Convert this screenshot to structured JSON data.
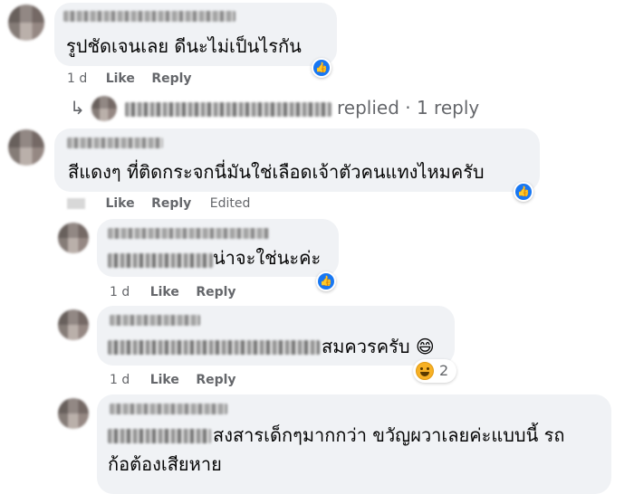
{
  "comments": [
    {
      "text": "รูปชัดเจนเลย ดีนะไม่เป็นไรกัน",
      "meta": {
        "time": "1 d",
        "like": "Like",
        "reply": "Reply"
      },
      "reaction": "like-icon",
      "replies_summary": {
        "text": "replied · 1 reply"
      }
    },
    {
      "text": "สีแดงๆ ที่ติดกระจกนี่มันใช่เลือดเจ้าตัวคนแทงไหมครับ",
      "meta": {
        "like": "Like",
        "reply": "Reply",
        "edited": "Edited"
      },
      "reaction": "like-icon",
      "replies": [
        {
          "text": "น่าจะใช่นะค่ะ",
          "meta": {
            "time": "1 d",
            "like": "Like",
            "reply": "Reply"
          },
          "reaction": "like-icon"
        },
        {
          "text": "สมควรครับ 😄",
          "meta": {
            "time": "1 d",
            "like": "Like",
            "reply": "Reply"
          },
          "reaction": "haha-icon",
          "reaction_count": "2"
        },
        {
          "text_line1": "สงสารเด็กๆมากกว่า ขวัญผวาเลยค่ะแบบนี้ รถ",
          "text_line2": "ก้อต้องเสียหาย"
        }
      ]
    }
  ],
  "colors": {
    "accent": "#1877f2",
    "bubble": "#f0f2f5",
    "meta": "#65676b"
  }
}
